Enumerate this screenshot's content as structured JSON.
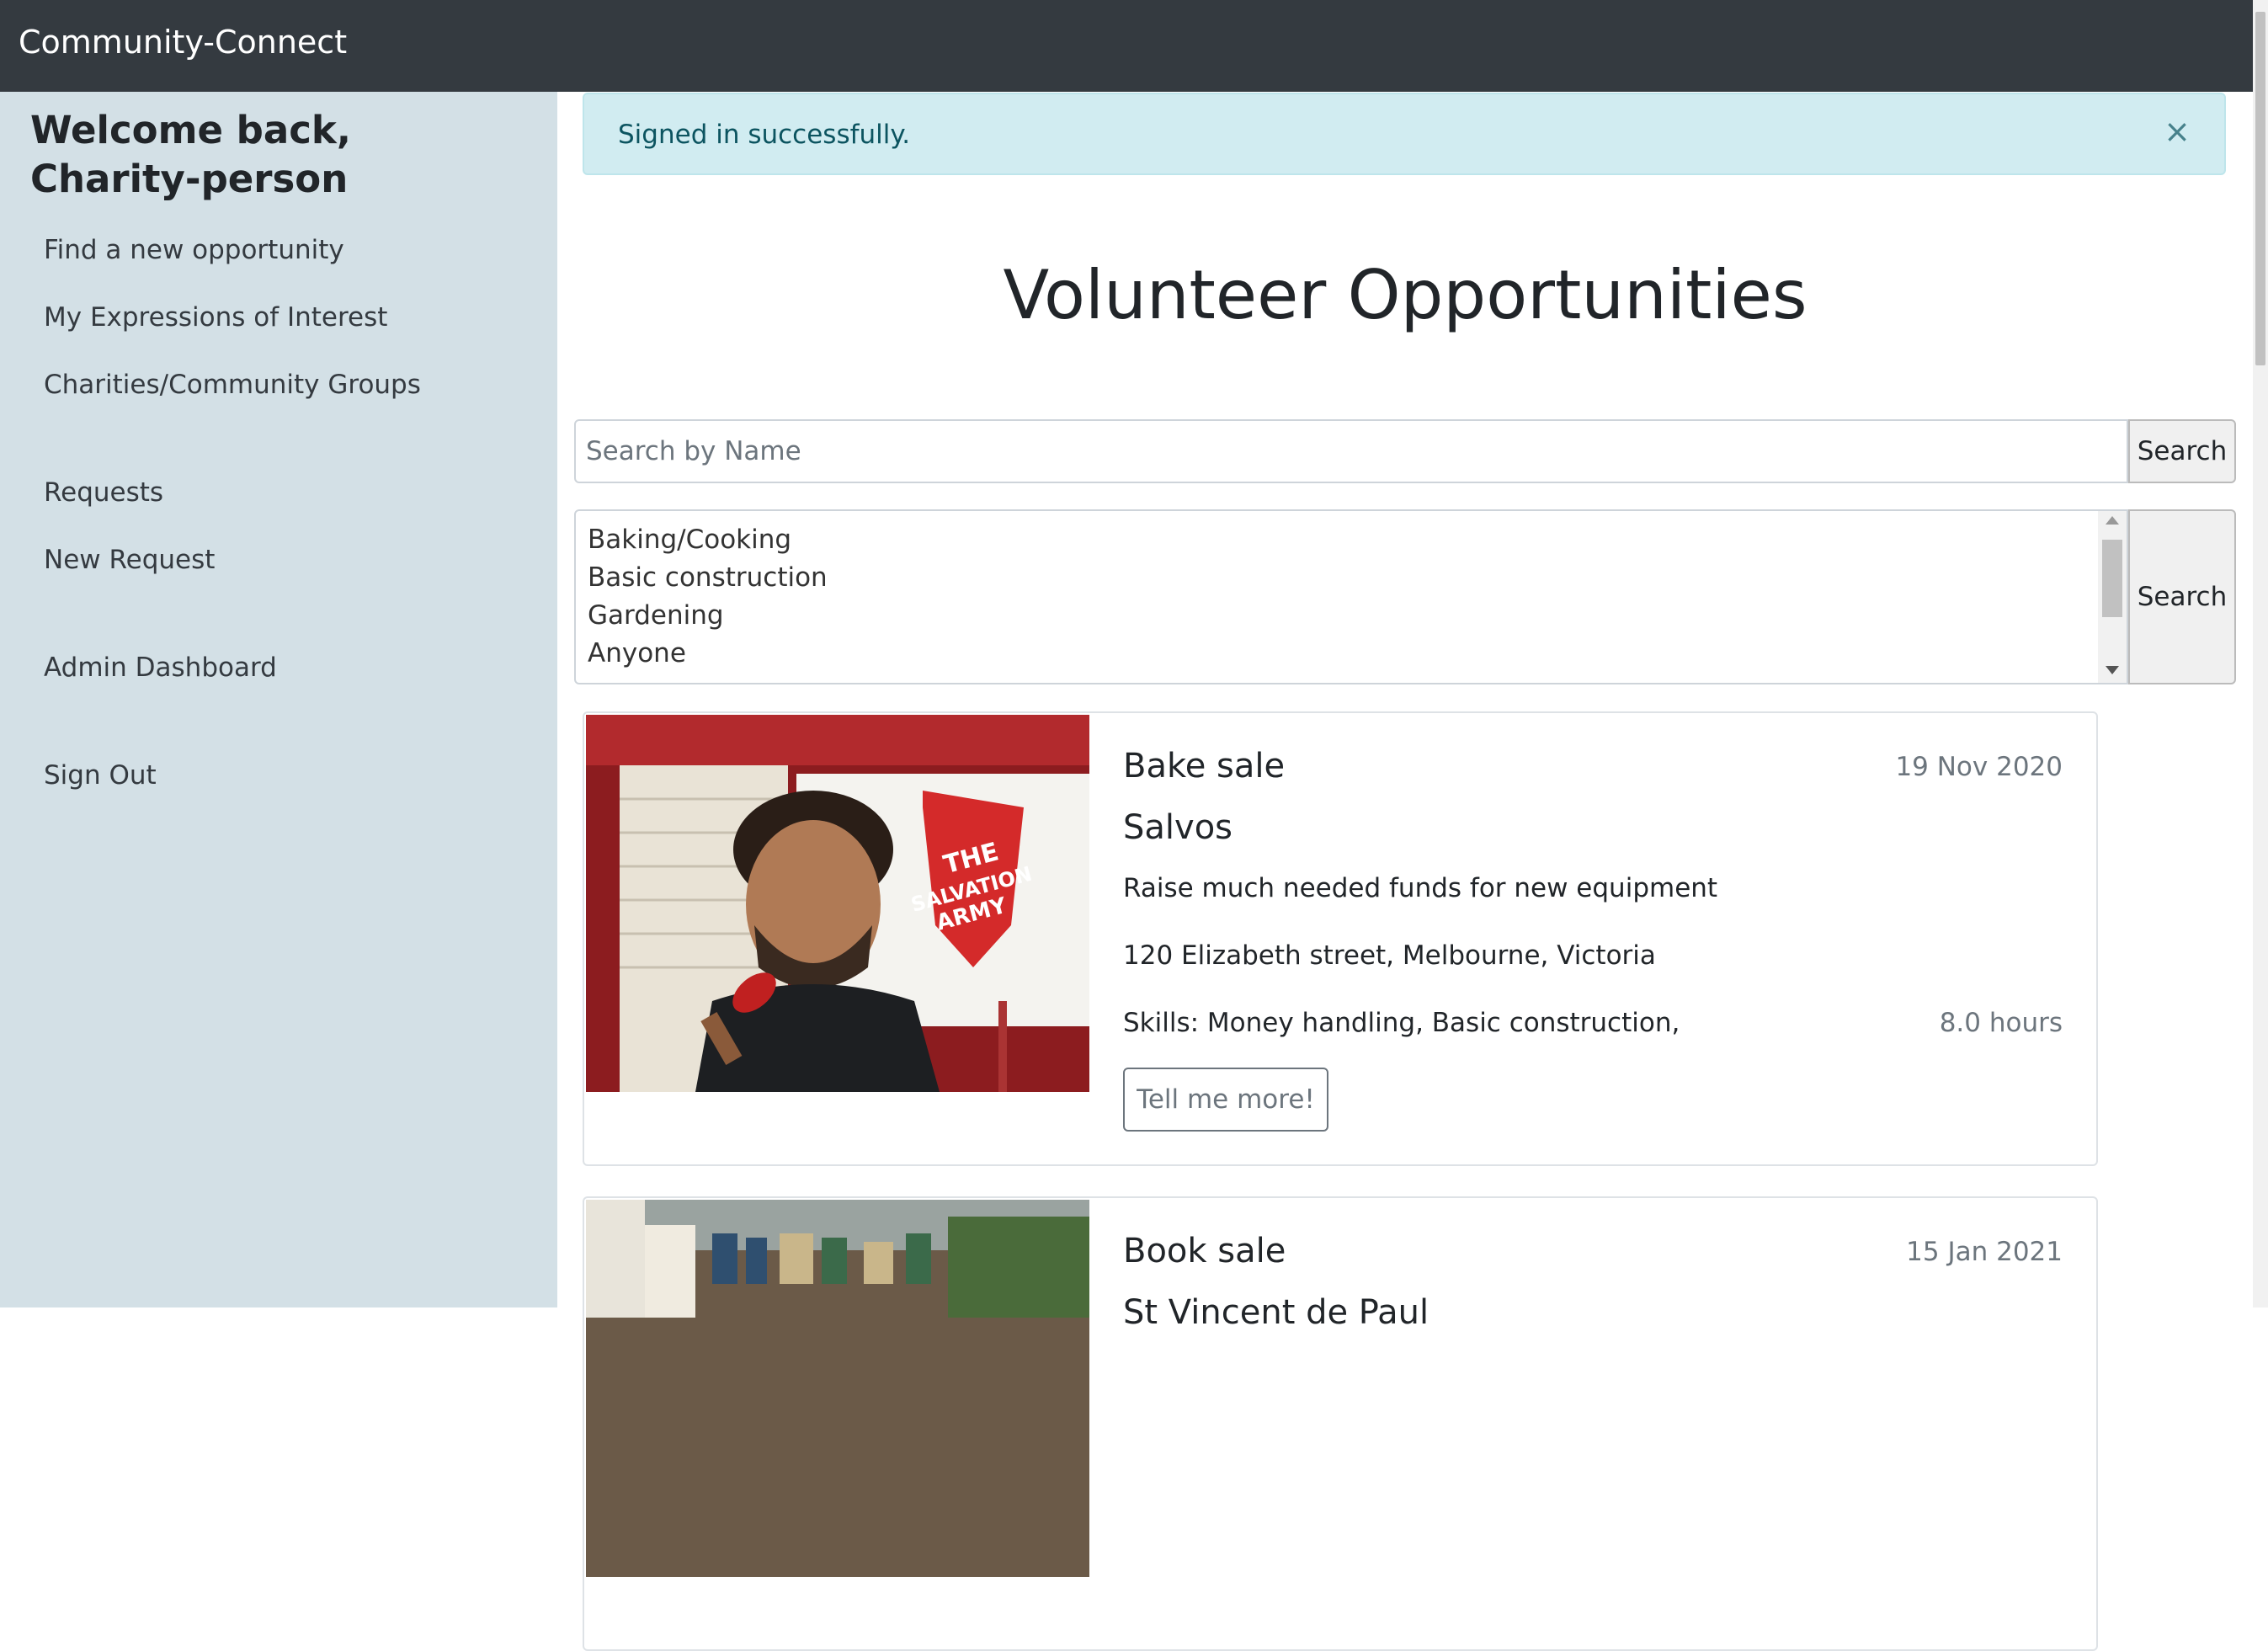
{
  "navbar": {
    "brand": "Community-Connect"
  },
  "sidebar": {
    "welcome": "Welcome back, Charity-person",
    "items": [
      {
        "label": "Find a new opportunity"
      },
      {
        "label": "My Expressions of Interest"
      },
      {
        "label": "Charities/Community Groups"
      },
      {
        "label": "Requests"
      },
      {
        "label": "New Request"
      },
      {
        "label": "Admin Dashboard"
      },
      {
        "label": "Sign Out"
      }
    ]
  },
  "alert": {
    "text": "Signed in successfully.",
    "close": "×"
  },
  "main": {
    "title": "Volunteer Opportunities",
    "search": {
      "placeholder": "Search by Name",
      "button": "Search"
    },
    "skills_filter": {
      "options": [
        "Baking/Cooking",
        "Basic construction",
        "Gardening",
        "Anyone"
      ],
      "button": "Search"
    },
    "cards": [
      {
        "title": "Bake sale",
        "date": "19 Nov 2020",
        "org": "Salvos",
        "description": "Raise much needed funds for new equipment",
        "address": "120 Elizabeth street, Melbourne, Victoria",
        "skills": "Skills: Money handling, Basic construction,",
        "hours": "8.0 hours",
        "button": "Tell me more!"
      },
      {
        "title": "Book sale",
        "date": "15 Jan 2021",
        "org": "St Vincent de Paul"
      }
    ]
  },
  "colors": {
    "navbar": "#343a40",
    "sidebar": "#d3e0e6",
    "alert_bg": "#d1ecf1",
    "alert_text": "#0c5460"
  }
}
